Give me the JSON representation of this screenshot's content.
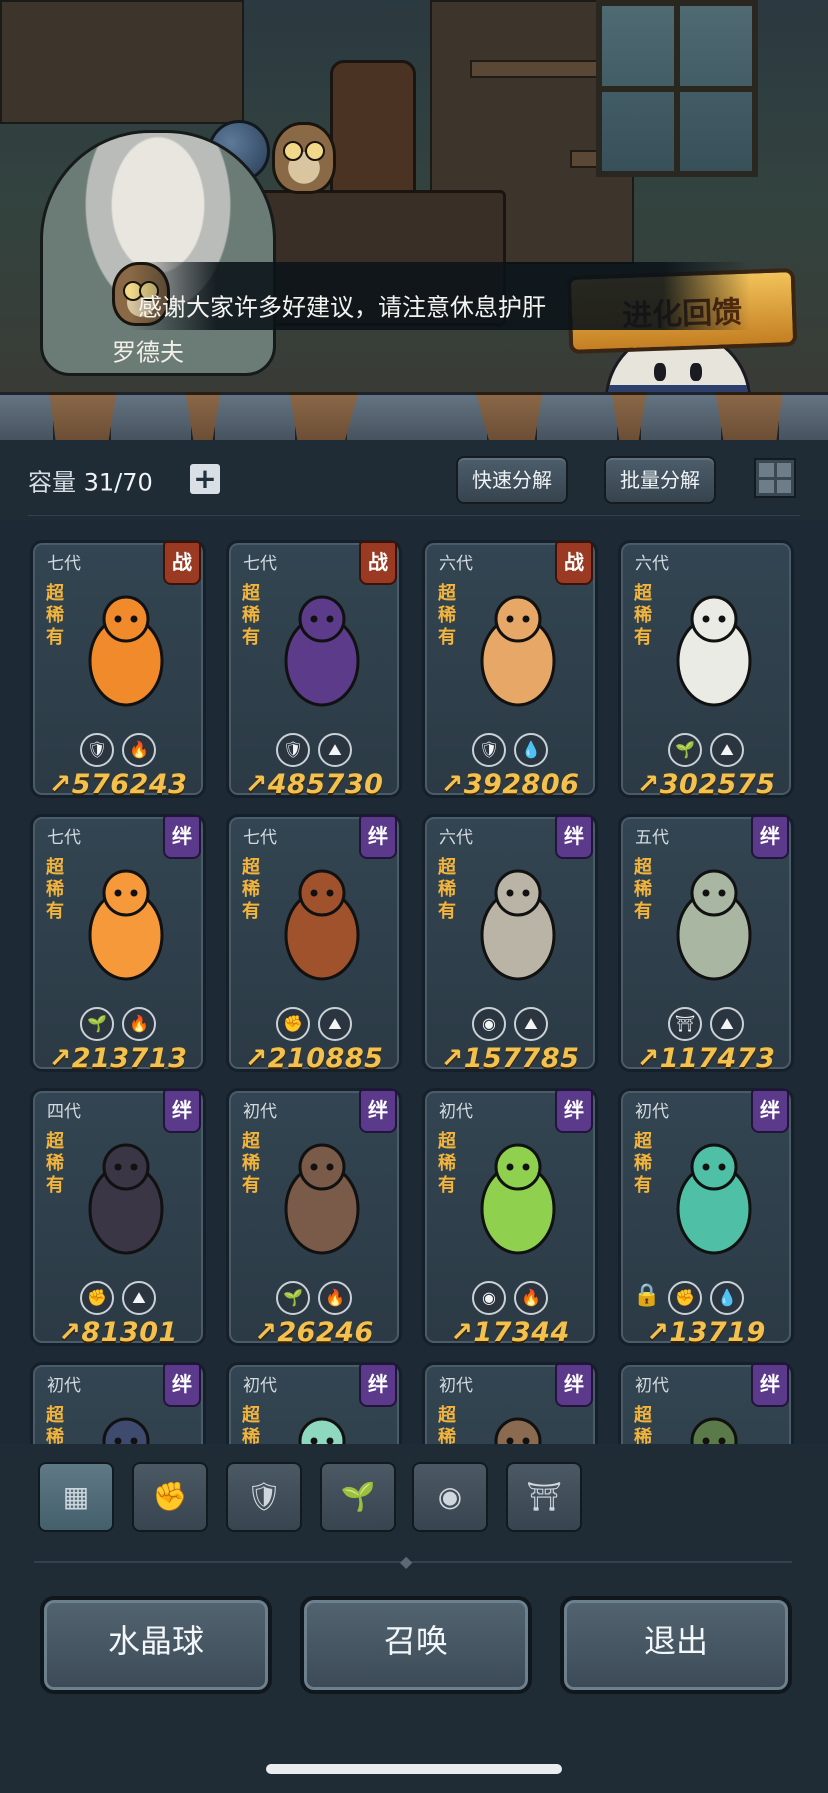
{
  "scene": {
    "npc_name": "罗德夫",
    "dialogue": "感谢大家许多好建议，请注意休息护肝",
    "event_banner": "进化回馈"
  },
  "toolbar": {
    "capacity_label": "容量",
    "capacity_value": "31/70",
    "add_label": "+",
    "quick_decompose": "快速分解",
    "batch_decompose": "批量分解"
  },
  "rarity_label": "超稀有",
  "pets": [
    {
      "gen": "七代",
      "tag": "战",
      "tag_type": "war",
      "badges": [
        "🛡",
        "🔥"
      ],
      "power": "576243",
      "color": "#f08a2a"
    },
    {
      "gen": "七代",
      "tag": "战",
      "tag_type": "war",
      "badges": [
        "🛡",
        "⛰"
      ],
      "power": "485730",
      "color": "#5b3b8a"
    },
    {
      "gen": "六代",
      "tag": "战",
      "tag_type": "war",
      "badges": [
        "🛡",
        "💧"
      ],
      "power": "392806",
      "color": "#e7a867"
    },
    {
      "gen": "六代",
      "tag": "",
      "tag_type": "",
      "badges": [
        "🌱",
        "⛰"
      ],
      "power": "302575",
      "color": "#e9ebe4"
    },
    {
      "gen": "七代",
      "tag": "绊",
      "tag_type": "bond",
      "badges": [
        "🌱",
        "🔥"
      ],
      "power": "213713",
      "color": "#f6993a"
    },
    {
      "gen": "七代",
      "tag": "绊",
      "tag_type": "bond",
      "badges": [
        "✊",
        "⛰"
      ],
      "power": "210885",
      "color": "#a0522d"
    },
    {
      "gen": "六代",
      "tag": "绊",
      "tag_type": "bond",
      "badges": [
        "◉",
        "⛰"
      ],
      "power": "157785",
      "color": "#b9b4a6"
    },
    {
      "gen": "五代",
      "tag": "绊",
      "tag_type": "bond",
      "badges": [
        "⛩",
        "⛰"
      ],
      "power": "117473",
      "color": "#a9b6a2"
    },
    {
      "gen": "四代",
      "tag": "绊",
      "tag_type": "bond",
      "badges": [
        "✊",
        "⛰"
      ],
      "power": "81301",
      "color": "#3a3646"
    },
    {
      "gen": "初代",
      "tag": "绊",
      "tag_type": "bond",
      "badges": [
        "🌱",
        "🔥"
      ],
      "power": "26246",
      "color": "#7a5a48"
    },
    {
      "gen": "初代",
      "tag": "绊",
      "tag_type": "bond",
      "badges": [
        "◉",
        "🔥"
      ],
      "power": "17344",
      "color": "#8fd14f"
    },
    {
      "gen": "初代",
      "tag": "绊",
      "tag_type": "bond",
      "badges": [
        "✊",
        "💧"
      ],
      "power": "13719",
      "color": "#4fbfa6",
      "locked": true
    },
    {
      "gen": "初代",
      "tag": "绊",
      "tag_type": "bond",
      "badges": [],
      "power": "",
      "color": "#3e4b6e"
    },
    {
      "gen": "初代",
      "tag": "绊",
      "tag_type": "bond",
      "badges": [],
      "power": "",
      "color": "#8fd8c0"
    },
    {
      "gen": "初代",
      "tag": "绊",
      "tag_type": "bond",
      "badges": [],
      "power": "",
      "color": "#8a6a50"
    },
    {
      "gen": "初代",
      "tag": "绊",
      "tag_type": "bond",
      "badges": [],
      "power": "",
      "color": "#5b7a4a"
    }
  ],
  "filters": [
    {
      "icon": "all-icon",
      "glyph": "▦",
      "active": true
    },
    {
      "icon": "fist-icon",
      "glyph": "✊",
      "active": false
    },
    {
      "icon": "shield-icon",
      "glyph": "🛡",
      "active": false
    },
    {
      "icon": "sprout-icon",
      "glyph": "🌱",
      "active": false
    },
    {
      "icon": "eye-icon",
      "glyph": "◉",
      "active": false
    },
    {
      "icon": "shrine-icon",
      "glyph": "⛩",
      "active": false
    }
  ],
  "actions": {
    "crystal_ball": "水晶球",
    "summon": "召唤",
    "exit": "退出"
  }
}
